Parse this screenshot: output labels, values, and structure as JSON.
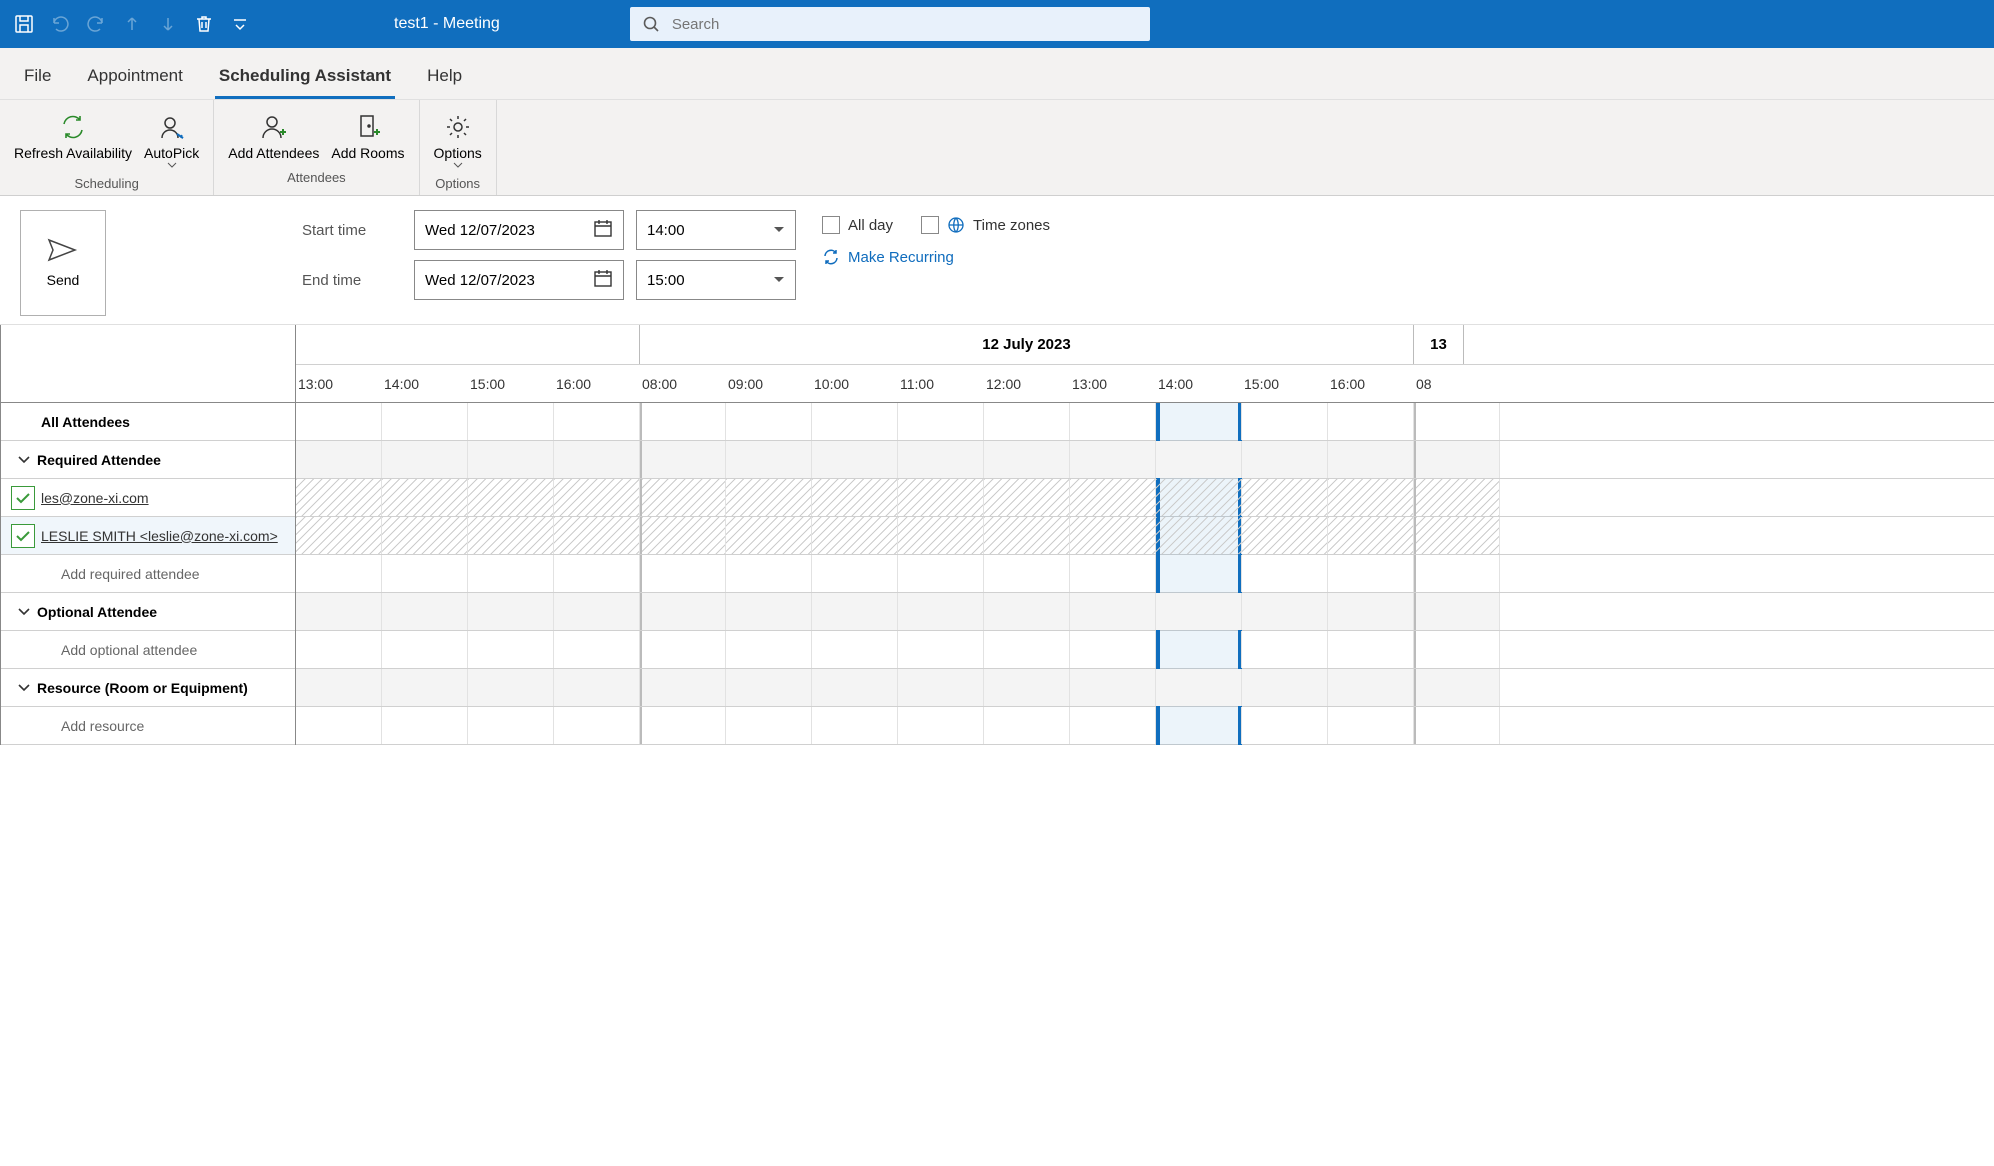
{
  "titlebar": {
    "title": "test1  -  Meeting",
    "search_placeholder": "Search"
  },
  "tabs": {
    "file": "File",
    "appointment": "Appointment",
    "scheduling": "Scheduling Assistant",
    "help": "Help"
  },
  "ribbon": {
    "refresh": "Refresh Availability",
    "autopick": "AutoPick",
    "addattendees": "Add Attendees",
    "addrooms": "Add Rooms",
    "options": "Options",
    "group_scheduling": "Scheduling",
    "group_attendees": "Attendees",
    "group_options": "Options"
  },
  "form": {
    "send": "Send",
    "start_label": "Start time",
    "end_label": "End time",
    "start_date": "Wed 12/07/2023",
    "end_date": "Wed 12/07/2023",
    "start_time": "14:00",
    "end_time": "15:00",
    "allday": "All day",
    "timezones": "Time zones",
    "recurring": "Make Recurring"
  },
  "attendees": {
    "all": "All Attendees",
    "required": "Required Attendee",
    "optional": "Optional Attendee",
    "resource": "Resource (Room or Equipment)",
    "add_required": "Add required attendee",
    "add_optional": "Add optional attendee",
    "add_resource": "Add resource",
    "rows": [
      {
        "name": "les@zone-xi.com"
      },
      {
        "name": "LESLIE SMITH  <leslie@zone-xi.com>"
      }
    ]
  },
  "grid": {
    "date_main": "12 July 2023",
    "date_next": "13",
    "hours_before": [
      "13:00",
      "14:00",
      "15:00",
      "16:00"
    ],
    "hours_main": [
      "08:00",
      "09:00",
      "10:00",
      "11:00",
      "12:00",
      "13:00",
      "14:00",
      "15:00",
      "16:00"
    ],
    "hours_after": [
      "08"
    ],
    "selection_start_col": 10,
    "selection_span": 1
  }
}
